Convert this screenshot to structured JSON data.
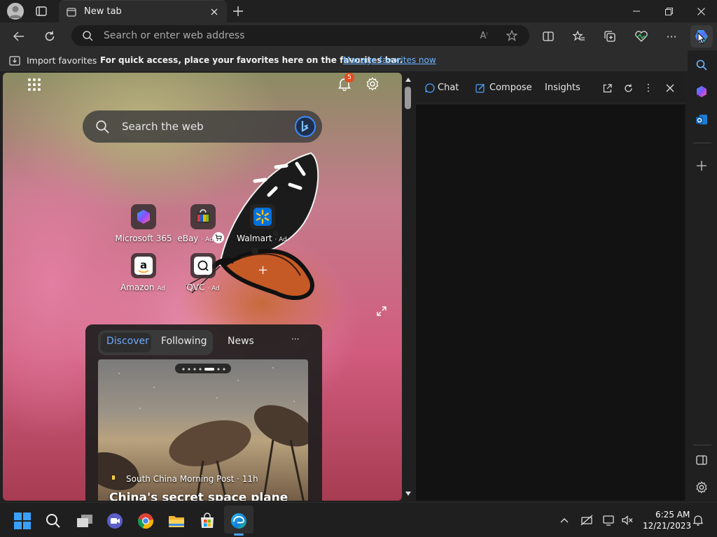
{
  "browser": {
    "tab_title": "New tab",
    "address_placeholder": "Search or enter web address"
  },
  "favorites_bar": {
    "import_label": "Import favorites",
    "hint": "For quick access, place your favorites here on the favorites bar.",
    "manage_link": "Manage favorites now"
  },
  "ntp": {
    "notification_count": "5",
    "search_placeholder": "Search the web",
    "quick_links": [
      {
        "label": "Microsoft 365",
        "ad": ""
      },
      {
        "label": "eBay",
        "ad": "· Ad"
      },
      {
        "label": "Walmart",
        "ad": "· Ad"
      },
      {
        "label": "Amazon",
        "ad": "Ad"
      },
      {
        "label": "QVC",
        "ad": "· Ad"
      }
    ],
    "add_tile": "+",
    "feed_tabs": [
      "Discover",
      "Following",
      "News"
    ],
    "feed_more": "···",
    "article": {
      "source": "South China Morning Post · 11h",
      "headline": "China's secret space plane"
    }
  },
  "copilot_pane": {
    "tabs": [
      "Chat",
      "Compose",
      "Insights"
    ]
  },
  "taskbar": {
    "time": "6:25 AM",
    "date": "12/21/2023"
  },
  "colors": {
    "accent": "#4aa3ff",
    "link": "#6cb4ff",
    "badge": "#e24c1f",
    "feed_active": "#6fa8ff"
  }
}
